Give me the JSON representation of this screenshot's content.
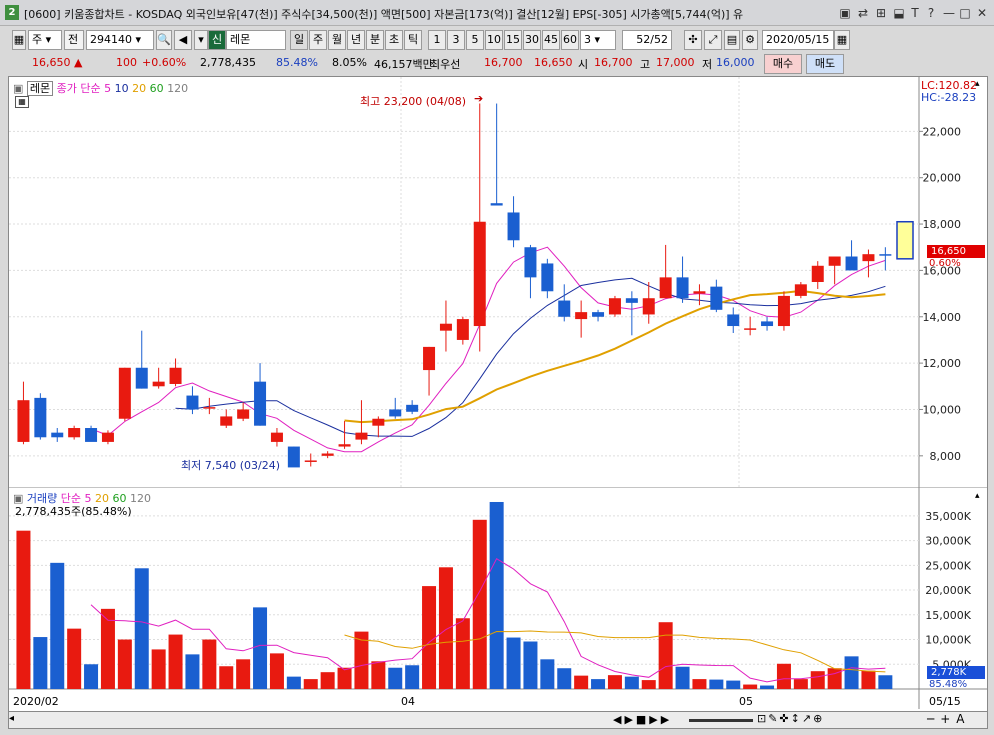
{
  "window": {
    "icon": "2",
    "title": "[0600] 키움종합차트 - KOSDAQ 외국인보유[47(천)] 주식수[34,500(천)] 액면[500] 자본금[173(억)] 결산[12월] EPS[-305] 시가총액[5,744(억)] 유"
  },
  "toolbar": {
    "period_type": "주",
    "code_label": "전",
    "code": "294140",
    "sin_label": "신",
    "name": "레몬",
    "intervals": [
      "일",
      "주",
      "월",
      "년",
      "분",
      "초",
      "틱"
    ],
    "selected_interval": "일",
    "minutes": [
      "1",
      "3",
      "5",
      "10",
      "15",
      "30",
      "45",
      "60"
    ],
    "count_select": "3",
    "page": "52/52",
    "date": "2020/05/15"
  },
  "quote": {
    "price": "16,650",
    "change_arrow": "▲",
    "change": "100",
    "change_pct": "+0.60%",
    "volume": "2,778,435",
    "vol_ratio": "85.48%",
    "turnover": "8.05%",
    "amount": "46,157백만",
    "best_bid_label": "최우선",
    "best_ask": "16,700",
    "best_bid": "16,650",
    "open_label": "시",
    "open": "16,700",
    "high_label": "고",
    "high": "17,000",
    "low_label": "저",
    "low": "16,000",
    "buy_button": "매수",
    "sell_button": "매도"
  },
  "price_panel": {
    "stock_tag": "레몬",
    "legend_prefix": "종가 단순",
    "ma_periods": [
      "5",
      "10",
      "20",
      "60",
      "120"
    ],
    "ma_colors": [
      "#e020c0",
      "#1a2f9e",
      "#e0a000",
      "#20a020",
      "#808080"
    ],
    "lc": "LC:120.82",
    "hc": "HC:-28.23",
    "high_note": "최고 23,200 (04/08)",
    "low_note": "최저 7,540 (03/24)",
    "current_price": "16,650",
    "current_pct": "0.60%",
    "y_ticks": [
      "8,000",
      "10,000",
      "12,000",
      "14,000",
      "16,000",
      "18,000",
      "20,000",
      "22,000"
    ]
  },
  "volume_panel": {
    "legend_prefix": "거래량",
    "legend_ma": "단순",
    "ma_periods": [
      "5",
      "20",
      "60",
      "120"
    ],
    "value_text": "2,778,435주(85.48%)",
    "current_vol": "2,778K",
    "current_pct": "85.48%",
    "y_ticks": [
      "5,000K",
      "10,000K",
      "15,000K",
      "20,000K",
      "25,000K",
      "30,000K",
      "35,000K"
    ]
  },
  "x_axis": {
    "labels": [
      "2020/02",
      "04",
      "05",
      "05/15"
    ]
  },
  "chart_data": {
    "type": "candlestick",
    "ylim": [
      7000,
      24000
    ],
    "vol_ylim": [
      0,
      38000
    ],
    "candles": [
      {
        "o": 8600,
        "h": 11200,
        "l": 8500,
        "c": 10400,
        "v": 32000
      },
      {
        "o": 10500,
        "h": 10700,
        "l": 8700,
        "c": 8800,
        "v": 10500
      },
      {
        "o": 9000,
        "h": 9200,
        "l": 8600,
        "c": 8800,
        "v": 25500
      },
      {
        "o": 8800,
        "h": 9300,
        "l": 8700,
        "c": 9200,
        "v": 12200
      },
      {
        "o": 9200,
        "h": 9300,
        "l": 8700,
        "c": 8600,
        "v": 5000
      },
      {
        "o": 8600,
        "h": 9100,
        "l": 8500,
        "c": 9000,
        "v": 16200
      },
      {
        "o": 9600,
        "h": 11800,
        "l": 9500,
        "c": 11800,
        "v": 10000
      },
      {
        "o": 11800,
        "h": 13400,
        "l": 10900,
        "c": 10900,
        "v": 24400
      },
      {
        "o": 11000,
        "h": 11800,
        "l": 10900,
        "c": 11200,
        "v": 8000
      },
      {
        "o": 11100,
        "h": 12200,
        "l": 11000,
        "c": 11800,
        "v": 11000
      },
      {
        "o": 10600,
        "h": 11000,
        "l": 9800,
        "c": 10000,
        "v": 7000
      },
      {
        "o": 10100,
        "h": 10500,
        "l": 9800,
        "c": 10100,
        "v": 10000
      },
      {
        "o": 9300,
        "h": 10000,
        "l": 9200,
        "c": 9700,
        "v": 4600
      },
      {
        "o": 9600,
        "h": 10300,
        "l": 9500,
        "c": 10000,
        "v": 6000
      },
      {
        "o": 11200,
        "h": 12000,
        "l": 9300,
        "c": 9300,
        "v": 16500
      },
      {
        "o": 8600,
        "h": 9200,
        "l": 8400,
        "c": 9000,
        "v": 7200
      },
      {
        "o": 8400,
        "h": 8400,
        "l": 7540,
        "c": 7500,
        "v": 2500
      },
      {
        "o": 7800,
        "h": 8100,
        "l": 7540,
        "c": 7800,
        "v": 2000
      },
      {
        "o": 8000,
        "h": 8200,
        "l": 7900,
        "c": 8100,
        "v": 3400
      },
      {
        "o": 8400,
        "h": 9500,
        "l": 8300,
        "c": 8500,
        "v": 4300
      },
      {
        "o": 8700,
        "h": 10400,
        "l": 8500,
        "c": 9000,
        "v": 11600
      },
      {
        "o": 9300,
        "h": 9700,
        "l": 8800,
        "c": 9600,
        "v": 5600
      },
      {
        "o": 10000,
        "h": 10500,
        "l": 9600,
        "c": 9700,
        "v": 4300
      },
      {
        "o": 10200,
        "h": 10400,
        "l": 9800,
        "c": 9900,
        "v": 4800
      },
      {
        "o": 11700,
        "h": 12700,
        "l": 10600,
        "c": 12700,
        "v": 20800
      },
      {
        "o": 13400,
        "h": 14700,
        "l": 12500,
        "c": 13700,
        "v": 24600
      },
      {
        "o": 13000,
        "h": 14000,
        "l": 12800,
        "c": 13900,
        "v": 14300
      },
      {
        "o": 13600,
        "h": 23200,
        "l": 12500,
        "c": 18100,
        "v": 34200
      },
      {
        "o": 18900,
        "h": 23200,
        "l": 18800,
        "c": 18800,
        "v": 37800
      },
      {
        "o": 18500,
        "h": 19200,
        "l": 17000,
        "c": 17300,
        "v": 10400
      },
      {
        "o": 17000,
        "h": 17100,
        "l": 14800,
        "c": 15700,
        "v": 9600
      },
      {
        "o": 16300,
        "h": 16500,
        "l": 14800,
        "c": 15100,
        "v": 6000
      },
      {
        "o": 14700,
        "h": 15400,
        "l": 13800,
        "c": 14000,
        "v": 4200
      },
      {
        "o": 13900,
        "h": 14700,
        "l": 13100,
        "c": 14200,
        "v": 2700
      },
      {
        "o": 14200,
        "h": 14300,
        "l": 13800,
        "c": 14000,
        "v": 2000
      },
      {
        "o": 14100,
        "h": 14900,
        "l": 14000,
        "c": 14800,
        "v": 2800
      },
      {
        "o": 14800,
        "h": 15100,
        "l": 13200,
        "c": 14600,
        "v": 2500
      },
      {
        "o": 14100,
        "h": 15500,
        "l": 13700,
        "c": 14800,
        "v": 1800
      },
      {
        "o": 14800,
        "h": 17100,
        "l": 14800,
        "c": 15700,
        "v": 13500
      },
      {
        "o": 15700,
        "h": 16600,
        "l": 14600,
        "c": 14800,
        "v": 4500
      },
      {
        "o": 15000,
        "h": 15400,
        "l": 14500,
        "c": 15100,
        "v": 2000
      },
      {
        "o": 15300,
        "h": 15600,
        "l": 14200,
        "c": 14300,
        "v": 1900
      },
      {
        "o": 14100,
        "h": 14400,
        "l": 13300,
        "c": 13600,
        "v": 1700
      },
      {
        "o": 13500,
        "h": 14000,
        "l": 13200,
        "c": 13500,
        "v": 900
      },
      {
        "o": 13800,
        "h": 14000,
        "l": 13400,
        "c": 13600,
        "v": 700
      },
      {
        "o": 13600,
        "h": 15100,
        "l": 13400,
        "c": 14900,
        "v": 5100
      },
      {
        "o": 14900,
        "h": 15500,
        "l": 14800,
        "c": 15400,
        "v": 2000
      },
      {
        "o": 15500,
        "h": 16400,
        "l": 15200,
        "c": 16200,
        "v": 3600
      },
      {
        "o": 16200,
        "h": 16600,
        "l": 15400,
        "c": 16600,
        "v": 4200
      },
      {
        "o": 16600,
        "h": 17300,
        "l": 16300,
        "c": 16000,
        "v": 6600
      },
      {
        "o": 16400,
        "h": 16900,
        "l": 15700,
        "c": 16700,
        "v": 3700
      },
      {
        "o": 16700,
        "h": 17000,
        "l": 16000,
        "c": 16650,
        "v": 2778
      }
    ]
  }
}
